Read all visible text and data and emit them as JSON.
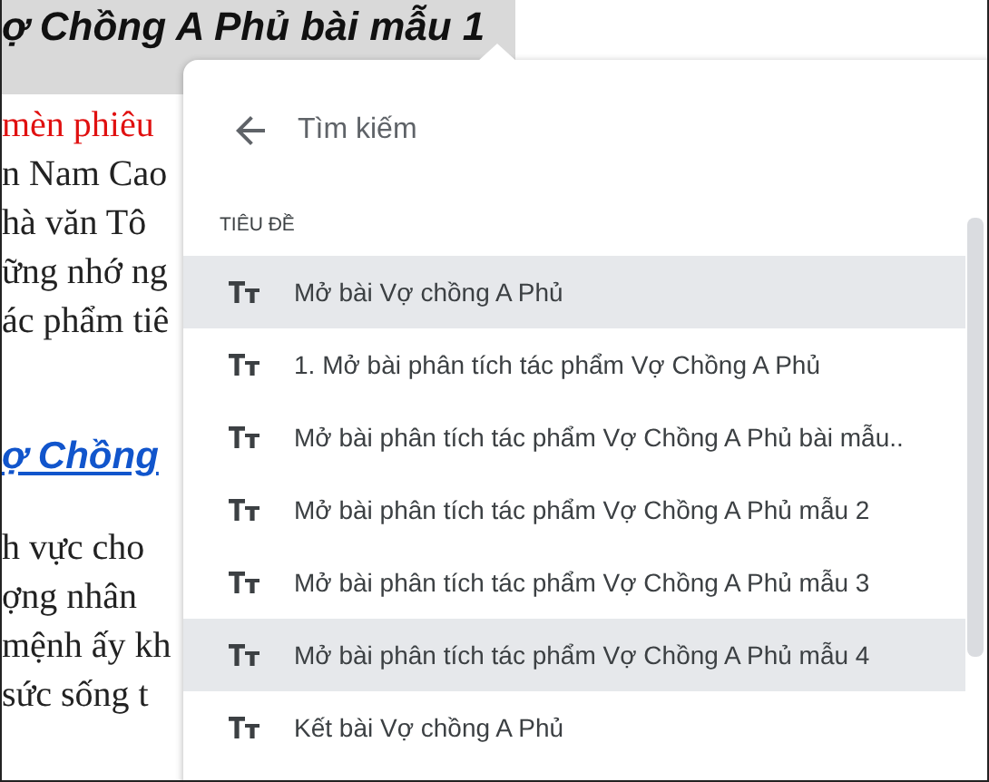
{
  "document": {
    "title": "ợ Chồng A Phủ bài mẫu 1",
    "paragraph_1": [
      {
        "text": "mèn phiêu",
        "kind": "red"
      },
      {
        "text": "n Nam Cao",
        "kind": "plain"
      },
      {
        "text": "hà văn Tô",
        "kind": "plain"
      },
      {
        "text": "ững nhớ ng",
        "kind": "plain"
      },
      {
        "text": "ác phẩm tiê",
        "kind": "plain"
      }
    ],
    "heading_link": "ợ Chồng",
    "paragraph_2": [
      "h vực cho",
      "ợng nhân",
      "mệnh ấy kh",
      "sức sống t"
    ]
  },
  "search_panel": {
    "placeholder": "Tìm kiếm",
    "section_label": "TIÊU ĐỀ",
    "results": [
      {
        "label": "Mở bài Vợ chồng A Phủ",
        "highlighted": true
      },
      {
        "label": "1. Mở bài phân tích tác phẩm Vợ Chồng A Phủ",
        "highlighted": false
      },
      {
        "label": "Mở bài phân tích tác phẩm Vợ Chồng A Phủ bài mẫu..",
        "highlighted": false
      },
      {
        "label": "Mở bài phân tích tác phẩm Vợ Chồng A Phủ mẫu 2",
        "highlighted": false
      },
      {
        "label": "Mở bài phân tích tác phẩm Vợ Chồng A Phủ mẫu 3",
        "highlighted": false
      },
      {
        "label": "Mở bài phân tích tác phẩm Vợ Chồng A Phủ mẫu 4",
        "highlighted": true
      },
      {
        "label": "Kết bài Vợ chồng A Phủ",
        "highlighted": false
      }
    ]
  }
}
